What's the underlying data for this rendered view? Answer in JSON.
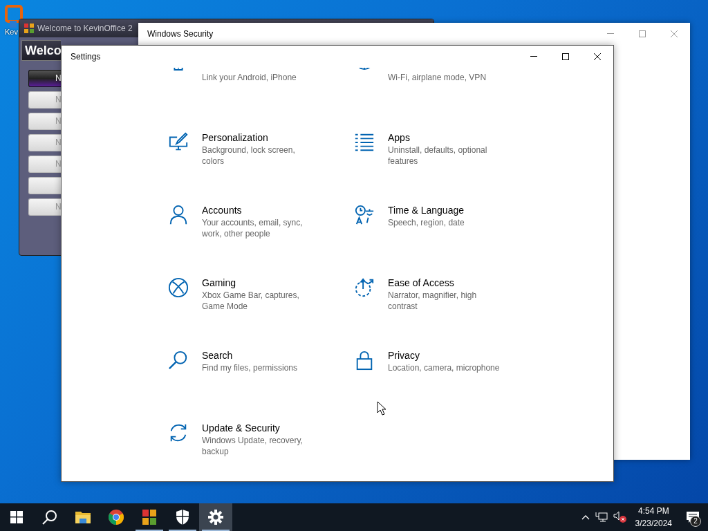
{
  "desktop_icons": [
    {
      "label": "Kev"
    }
  ],
  "kevin_office": {
    "title": "Welcome to KevinOffice 2",
    "heading": "Welco",
    "buttons": [
      {
        "label": "N",
        "selected": true
      },
      {
        "label": "N",
        "selected": false
      },
      {
        "label": "N",
        "selected": false
      },
      {
        "label": "N",
        "selected": false
      },
      {
        "label": "N",
        "selected": false
      },
      {
        "selected": false
      },
      {
        "label": "N",
        "selected": false
      }
    ]
  },
  "windows_security": {
    "title": "Windows Security"
  },
  "settings": {
    "title": "Settings",
    "tiles": [
      {
        "description": "Link your Android, iPhone"
      },
      {
        "description": "Wi-Fi, airplane mode, VPN"
      },
      {
        "title": "Personalization",
        "description": "Background, lock screen, colors"
      },
      {
        "title": "Apps",
        "description": "Uninstall, defaults, optional features"
      },
      {
        "title": "Accounts",
        "description": "Your accounts, email, sync, work, other people"
      },
      {
        "title": "Time & Language",
        "description": "Speech, region, date"
      },
      {
        "title": "Gaming",
        "description": "Xbox Game Bar, captures, Game Mode"
      },
      {
        "title": "Ease of Access",
        "description": "Narrator, magnifier, high contrast"
      },
      {
        "title": "Search",
        "description": "Find my files, permissions"
      },
      {
        "title": "Privacy",
        "description": "Location, camera, microphone"
      },
      {
        "title": "Update & Security",
        "description": "Windows Update, recovery, backup"
      }
    ]
  },
  "taskbar": {
    "items": [
      {
        "running": false,
        "selected": false
      },
      {
        "running": false,
        "selected": false
      },
      {
        "running": true,
        "selected": false
      },
      {
        "running": true,
        "selected": false
      },
      {
        "running": true,
        "selected": true
      }
    ],
    "volume_muted": true,
    "clock": {
      "time": "4:54 PM",
      "date": "3/23/2024"
    },
    "notification_count": "2"
  }
}
